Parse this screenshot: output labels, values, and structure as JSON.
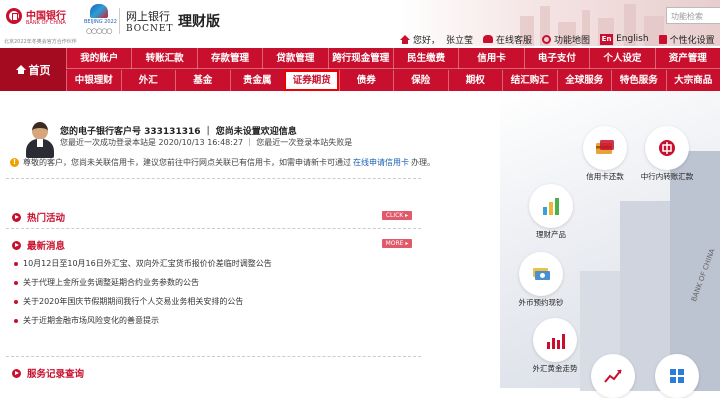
{
  "header": {
    "bank_cn": "中国银行",
    "bank_en": "BANK OF CHINA",
    "olympic_text": "BEIJING 2022",
    "sponsor_note": "北京2022年冬奥会官方合作伙伴",
    "bank_name": "网上银行",
    "bank_name_en": "BOCNET",
    "edition": "理财版",
    "search_placeholder": "功能检索",
    "userbar": {
      "greeting": "您好，",
      "username": "张立莹",
      "service": "在线客服",
      "map": "功能地图",
      "lang_tag": "En",
      "lang": "English",
      "personal": "个性化设置"
    }
  },
  "nav": {
    "home": "首页",
    "row1": [
      "我的账户",
      "转账汇款",
      "存款管理",
      "贷款管理",
      "跨行现金管理",
      "民生缴费",
      "信用卡",
      "电子支付",
      "个人设定",
      "资产管理"
    ],
    "row2": [
      "中银理财",
      "外汇",
      "基金",
      "贵金属",
      "证券期货",
      "债券",
      "保险",
      "期权",
      "结汇购汇",
      "全球服务",
      "特色服务",
      "大宗商品"
    ],
    "active": "证券期货"
  },
  "customer": {
    "line1": "您的电子银行客户号 333131316 ｜ 您尚未设置欢迎信息",
    "line2": "您最近一次成功登录本站是 2020/10/13 16:48:27    ｜ 您最近一次登录本站失败是"
  },
  "notice": {
    "text": "尊敬的客户，您尚未关联信用卡，建议您前往中行网点关联已有信用卡，如需申请新卡可通过",
    "link": "在线申请信用卡",
    "suffix": "办理。"
  },
  "sections": {
    "hot": "热门活动",
    "hot_tag": "CLICK ▸",
    "news": "最新消息",
    "news_tag": "MORE ▸",
    "records": "服务记录查询"
  },
  "news": [
    "10月12日至10月16日外汇宝、双向外汇宝货币报价价差临时调整公告",
    "关于代理上金所业务调整延期合约业务参数的公告",
    "关于2020年国庆节假期期间我行个人交易业务相关安排的公告",
    "关于近期金融市场风险变化的善意提示"
  ],
  "quick_links": [
    "信用卡还款",
    "中行内转账汇款",
    "理财产品",
    "外币预约现钞",
    "外汇黄金走势"
  ],
  "bank_sign": "BANK OF CHINA"
}
